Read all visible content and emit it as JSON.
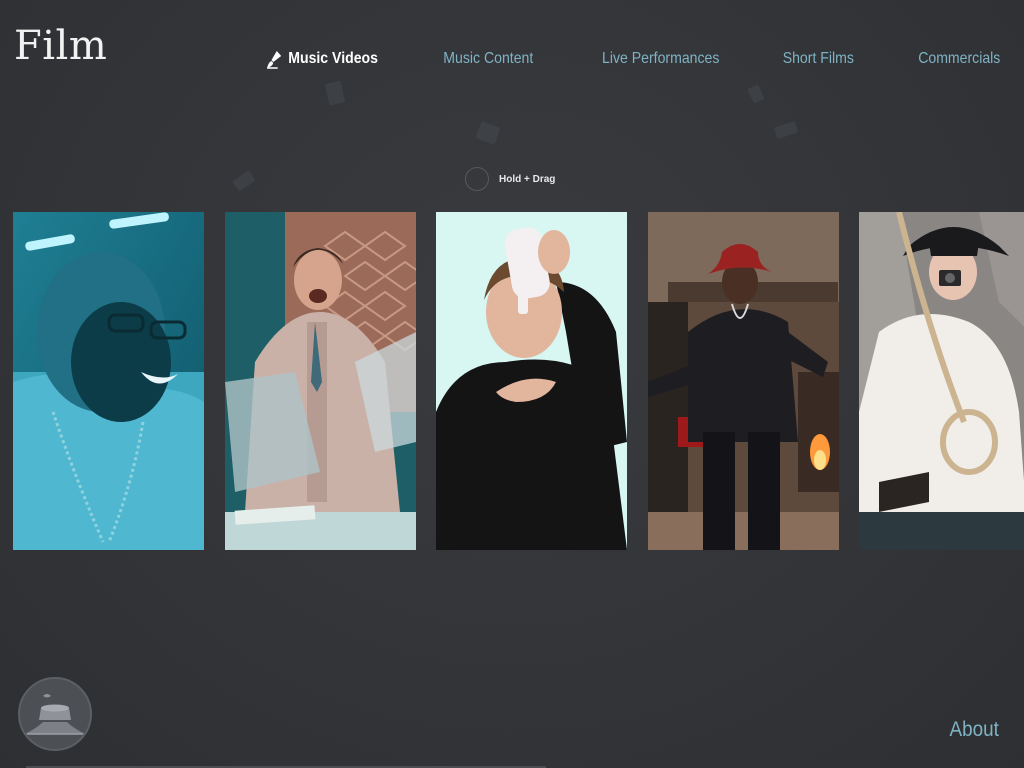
{
  "header": {
    "logo": "Film"
  },
  "nav": {
    "items": [
      {
        "label": "Music Videos",
        "active": true
      },
      {
        "label": "Music Content",
        "active": false
      },
      {
        "label": "Live Performances",
        "active": false
      },
      {
        "label": "Short Films",
        "active": false
      },
      {
        "label": "Commercials",
        "active": false
      }
    ]
  },
  "carousel": {
    "hint": "Hold + Drag",
    "cards": [
      {
        "subject": "woman-laughing-blue-tint"
      },
      {
        "subject": "man-in-suit-laughing"
      },
      {
        "subject": "person-with-bottle"
      },
      {
        "subject": "performer-in-red-hat"
      },
      {
        "subject": "woman-with-camera"
      }
    ]
  },
  "footer": {
    "about": "About"
  },
  "colors": {
    "background": "#323438",
    "nav_link": "#7fb3c4",
    "nav_active": "#ffffff"
  }
}
